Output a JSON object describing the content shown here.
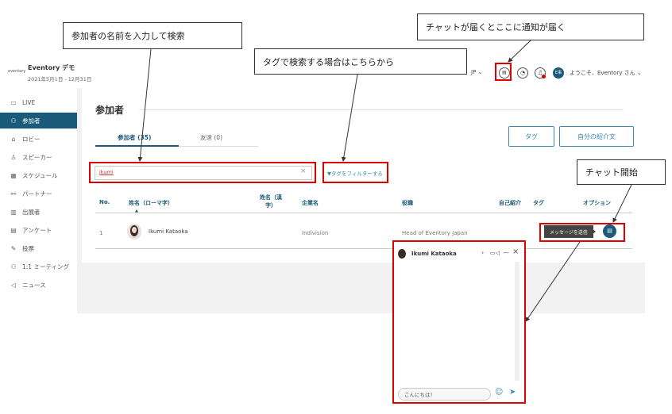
{
  "event": {
    "logo": "eventory",
    "title": "Eventory デモ",
    "date_range": "2021年5月1日 - 12月31日"
  },
  "header": {
    "language": "JP",
    "user_initials": "E事",
    "greeting": "ようこそ、Eventory さん"
  },
  "sidebar": {
    "items": [
      {
        "label": "LIVE",
        "icon": "screen-icon"
      },
      {
        "label": "参加者",
        "icon": "person-icon",
        "active": true
      },
      {
        "label": "ロビー",
        "icon": "home-icon"
      },
      {
        "label": "スピーカー",
        "icon": "speaker-icon"
      },
      {
        "label": "スケジュール",
        "icon": "calendar-icon"
      },
      {
        "label": "パートナー",
        "icon": "partner-icon"
      },
      {
        "label": "出展者",
        "icon": "building-icon"
      },
      {
        "label": "アンケート",
        "icon": "survey-icon"
      },
      {
        "label": "投票",
        "icon": "vote-icon"
      },
      {
        "label": "1:1 ミーティング",
        "icon": "meeting-icon"
      },
      {
        "label": "ニュース",
        "icon": "megaphone-icon"
      }
    ]
  },
  "main": {
    "title": "参加者",
    "tabs": [
      {
        "label": "参加者 (35)",
        "active": true
      },
      {
        "label": "友達 (0)",
        "active": false
      }
    ],
    "buttons": {
      "tag": "タグ",
      "self_intro": "自分の紹介文"
    },
    "search": {
      "value": "ikumi"
    },
    "tag_filter": "タグをフィルターする",
    "table": {
      "headers": [
        "No.",
        "姓名（ローマ字）",
        "姓名（漢字）",
        "企業名",
        "役職",
        "自己紹介",
        "タグ",
        "オプション"
      ],
      "rows": [
        {
          "no": "1",
          "name": "Ikumi Kataoka",
          "kanji": "",
          "company": "Indivision",
          "title": "Head of Eventory Japan",
          "intro": "",
          "tag": ""
        }
      ]
    },
    "message_button": "メッセージを送信"
  },
  "chat": {
    "name": "Ikumi Kataoka",
    "input": "こんにちは！"
  },
  "annotations": {
    "search": "参加者の名前を入力して検索",
    "tag": "タグで検索する場合はこちらから",
    "notify": "チャットが届くとここに通知が届く",
    "chat_start": "チャット開始"
  },
  "colors": {
    "accent": "#1a5a7a",
    "link": "#3a8bb0",
    "highlight": "#e00000"
  }
}
